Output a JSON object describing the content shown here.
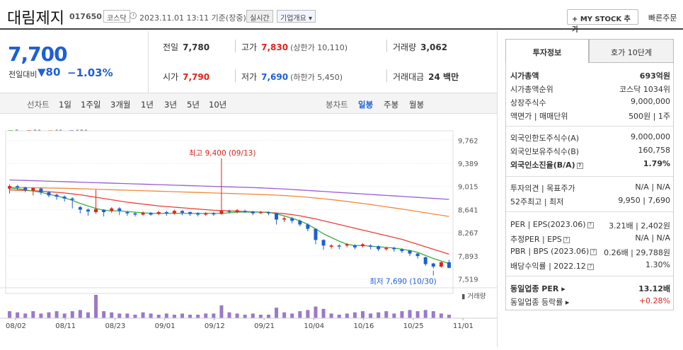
{
  "header": {
    "name": "대림제지",
    "code": "017650",
    "market": "코스닥",
    "datetime": "2023.11.01 13:11 기준(장중)",
    "realtime": "실시간",
    "corp_info": "기업개요 ▾",
    "mystock": "+ MY STOCK 추가",
    "quick_order": "빠른주문"
  },
  "price": {
    "current": "7,700",
    "change_label": "전일대비",
    "change": "▼80",
    "change_pct": "−1.03%"
  },
  "stats": {
    "prev_label": "전일",
    "prev": "7,780",
    "high_label": "고가",
    "high": "7,830",
    "upper_limit": "(상한가 10,110)",
    "volume_label": "거래량",
    "volume": "3,062",
    "open_label": "시가",
    "open": "7,790",
    "low_label": "저가",
    "low": "7,690",
    "lower_limit": "(하한가 5,450)",
    "amount_label": "거래대금",
    "amount": "24 백만"
  },
  "periods": {
    "label": "선차트",
    "items": [
      "1일",
      "1주일",
      "3개월",
      "1년",
      "3년",
      "5년",
      "10년"
    ]
  },
  "candle": {
    "label": "봉차트",
    "items": [
      "일봉",
      "주봉",
      "월봉"
    ],
    "selected": "일봉"
  },
  "colors": {
    "up": "#e0241c",
    "down": "#1e5fd6",
    "ma5": "#3dad3d",
    "ma20": "#e8403a",
    "ma60": "#f08a3a",
    "ma120": "#9a5cd0"
  },
  "chart_data": {
    "type": "candlestick",
    "legend": [
      "5",
      "20",
      "60",
      "120"
    ],
    "y_ticks": [
      "9,762",
      "9,389",
      "9,015",
      "8,641",
      "8,267",
      "7,893",
      "7,519"
    ],
    "ylim": [
      7400,
      9800
    ],
    "x_labels": [
      "08/02",
      "08/11",
      "08/23",
      "09/01",
      "09/12",
      "09/21",
      "10/04",
      "10/16",
      "10/25",
      "11/01"
    ],
    "high_label": "최고 9,400 (09/13)",
    "low_label": "최저 7,690 (10/30)",
    "volume_label": "거래량",
    "candles": [
      [
        8980,
        9020,
        8990,
        9050,
        8900
      ],
      [
        9020,
        9000,
        8960,
        9040,
        8950
      ],
      [
        9000,
        8960,
        8940,
        9010,
        8920
      ],
      [
        8950,
        8990,
        8880,
        9000,
        8870
      ],
      [
        8980,
        8920,
        8900,
        9000,
        8880
      ],
      [
        8920,
        8870,
        8860,
        8940,
        8840
      ],
      [
        8880,
        8850,
        8820,
        8900,
        8800
      ],
      [
        8850,
        8820,
        8780,
        8870,
        8770
      ],
      [
        8820,
        8800,
        8680,
        8840,
        8660
      ],
      [
        8680,
        8640,
        8590,
        8700,
        8580
      ],
      [
        8640,
        8610,
        8560,
        8660,
        8540
      ],
      [
        8600,
        8650,
        8580,
        8960,
        8570
      ],
      [
        8640,
        8600,
        8540,
        8650,
        8530
      ],
      [
        8620,
        8660,
        8600,
        8680,
        8590
      ],
      [
        8660,
        8620,
        8560,
        8680,
        8550
      ],
      [
        8600,
        8580,
        8550,
        8620,
        8540
      ],
      [
        8580,
        8560,
        8540,
        8600,
        8530
      ],
      [
        8560,
        8590,
        8550,
        8610,
        8540
      ],
      [
        8590,
        8560,
        8550,
        8600,
        8540
      ],
      [
        8570,
        8600,
        8560,
        8620,
        8550
      ],
      [
        8600,
        8580,
        8560,
        8620,
        8540
      ],
      [
        8580,
        8620,
        8570,
        8640,
        8560
      ],
      [
        8620,
        8590,
        8560,
        8630,
        8550
      ],
      [
        8600,
        8570,
        8550,
        8610,
        8540
      ],
      [
        8580,
        8560,
        8540,
        8600,
        8530
      ],
      [
        8560,
        8580,
        8550,
        8600,
        8540
      ],
      [
        8580,
        8570,
        8550,
        8600,
        8540
      ],
      [
        8570,
        8620,
        8560,
        9400,
        8560
      ],
      [
        8620,
        8610,
        8590,
        8640,
        8580
      ],
      [
        8600,
        8630,
        8590,
        8650,
        8580
      ],
      [
        8620,
        8610,
        8600,
        8640,
        8590
      ],
      [
        8610,
        8580,
        8560,
        8620,
        8550
      ],
      [
        8590,
        8600,
        8580,
        8620,
        8570
      ],
      [
        8600,
        8580,
        8560,
        8610,
        8550
      ],
      [
        8580,
        8480,
        8420,
        8590,
        8400
      ],
      [
        8480,
        8500,
        8460,
        8530,
        8440
      ],
      [
        8500,
        8460,
        8440,
        8520,
        8420
      ],
      [
        8460,
        8400,
        8380,
        8480,
        8370
      ],
      [
        8400,
        8330,
        8300,
        8420,
        8290
      ],
      [
        8330,
        8150,
        8100,
        8340,
        8080
      ],
      [
        8150,
        8060,
        8000,
        8160,
        7990
      ],
      [
        8040,
        8060,
        8020,
        8080,
        8010
      ],
      [
        8060,
        8050,
        8020,
        8080,
        8000
      ],
      [
        8060,
        8080,
        8040,
        8100,
        8030
      ],
      [
        8060,
        8030,
        8020,
        8080,
        8000
      ],
      [
        8050,
        8080,
        8040,
        8100,
        8030
      ],
      [
        8060,
        8040,
        8010,
        8080,
        8000
      ],
      [
        8050,
        8000,
        7980,
        8060,
        7970
      ],
      [
        8000,
        8020,
        7990,
        8040,
        7980
      ],
      [
        8020,
        8000,
        7980,
        8040,
        7960
      ],
      [
        8000,
        7970,
        7950,
        8020,
        7940
      ],
      [
        7980,
        7930,
        7900,
        7990,
        7890
      ],
      [
        7930,
        7890,
        7860,
        7940,
        7850
      ],
      [
        7870,
        7760,
        7740,
        7880,
        7730
      ],
      [
        7770,
        7720,
        7700,
        7780,
        7690
      ],
      [
        7720,
        7790,
        7710,
        7800,
        7700
      ],
      [
        7790,
        7700,
        7690,
        7830,
        7690
      ]
    ],
    "ma5": [
      8990,
      8980,
      8960,
      8940,
      8920,
      8890,
      8860,
      8830,
      8790,
      8740,
      8700,
      8660,
      8630,
      8620,
      8620,
      8610,
      8600,
      8590,
      8580,
      8580,
      8580,
      8580,
      8580,
      8580,
      8580,
      8580,
      8580,
      8580,
      8590,
      8600,
      8600,
      8600,
      8600,
      8600,
      8570,
      8540,
      8500,
      8460,
      8400,
      8330,
      8250,
      8190,
      8130,
      8080,
      8060,
      8060,
      8050,
      8040,
      8030,
      8020,
      8000,
      7980,
      7950,
      7900,
      7850,
      7810,
      7770
    ],
    "ma20": [
      8960,
      8955,
      8950,
      8945,
      8940,
      8930,
      8920,
      8910,
      8895,
      8880,
      8860,
      8840,
      8820,
      8800,
      8780,
      8760,
      8745,
      8730,
      8715,
      8700,
      8690,
      8680,
      8670,
      8660,
      8650,
      8640,
      8630,
      8625,
      8620,
      8615,
      8610,
      8605,
      8600,
      8595,
      8585,
      8575,
      8560,
      8540,
      8515,
      8490,
      8460,
      8430,
      8400,
      8370,
      8340,
      8310,
      8280,
      8250,
      8220,
      8190,
      8160,
      8120,
      8080,
      8040,
      8000,
      7960,
      7920
    ],
    "ma60": [
      9000,
      8998,
      8996,
      8994,
      8992,
      8990,
      8988,
      8985,
      8982,
      8978,
      8974,
      8970,
      8966,
      8962,
      8958,
      8954,
      8950,
      8946,
      8942,
      8938,
      8934,
      8930,
      8926,
      8922,
      8918,
      8914,
      8910,
      8906,
      8902,
      8898,
      8894,
      8890,
      8885,
      8880,
      8874,
      8868,
      8860,
      8850,
      8840,
      8828,
      8816,
      8802,
      8788,
      8772,
      8756,
      8740,
      8722,
      8704,
      8686,
      8668,
      8650,
      8630,
      8610,
      8590,
      8570,
      8550,
      8530
    ],
    "ma120": [
      9120,
      9116,
      9112,
      9108,
      9104,
      9100,
      9096,
      9092,
      9088,
      9084,
      9080,
      9076,
      9072,
      9068,
      9064,
      9060,
      9056,
      9052,
      9048,
      9044,
      9040,
      9036,
      9032,
      9028,
      9024,
      9020,
      9016,
      9012,
      9008,
      9004,
      9000,
      8996,
      8992,
      8986,
      8980,
      8974,
      8966,
      8958,
      8950,
      8942,
      8934,
      8926,
      8918,
      8910,
      8902,
      8894,
      8886,
      8878,
      8870,
      8862,
      8854,
      8846,
      8838,
      8830,
      8822,
      8814,
      8806
    ],
    "volumes": [
      0.3,
      0.25,
      0.2,
      0.3,
      0.2,
      0.25,
      0.3,
      0.2,
      0.3,
      0.35,
      0.25,
      1.0,
      0.3,
      0.25,
      0.2,
      0.2,
      0.15,
      0.25,
      0.2,
      0.15,
      0.2,
      0.15,
      0.2,
      0.15,
      0.15,
      0.2,
      0.2,
      0.55,
      0.25,
      0.2,
      0.15,
      0.2,
      0.15,
      0.15,
      0.45,
      0.25,
      0.2,
      0.3,
      0.35,
      0.5,
      0.4,
      0.2,
      0.15,
      0.2,
      0.25,
      0.3,
      0.2,
      0.25,
      0.3,
      0.2,
      0.3,
      0.35,
      0.3,
      0.35,
      0.3,
      0.2,
      0.15
    ]
  },
  "tabs": [
    "투자정보",
    "호가 10단계"
  ],
  "invest": {
    "r1": [
      [
        "시가총액",
        "693억원"
      ],
      [
        "시가총액순위",
        "코스닥 1034위"
      ],
      [
        "상장주식수",
        "9,000,000"
      ],
      [
        "액면가 | 매매단위",
        "500원 | 1주"
      ]
    ],
    "r2": [
      [
        "외국인한도주식수(A)",
        "9,000,000"
      ],
      [
        "외국인보유주식수(B)",
        "160,758"
      ],
      [
        "외국인소진율(B/A)",
        "1.79%"
      ]
    ],
    "r3": [
      [
        "투자의견 | 목표주가",
        "N/A | N/A"
      ],
      [
        "52주최고 | 최저",
        "9,950 | 7,690"
      ]
    ],
    "r4": [
      [
        "PER | EPS(2023.06)",
        "3.21배 | 2,402원"
      ],
      [
        "추정PER | EPS",
        "N/A | N/A"
      ],
      [
        "PBR | BPS (2023.06)",
        "0.26배 | 29,788원"
      ],
      [
        "배당수익률 | 2022.12",
        "1.30%"
      ]
    ],
    "r5": [
      [
        "동일업종 PER",
        "13.12배"
      ],
      [
        "동일업종 등락률",
        "+0.28%"
      ]
    ]
  }
}
